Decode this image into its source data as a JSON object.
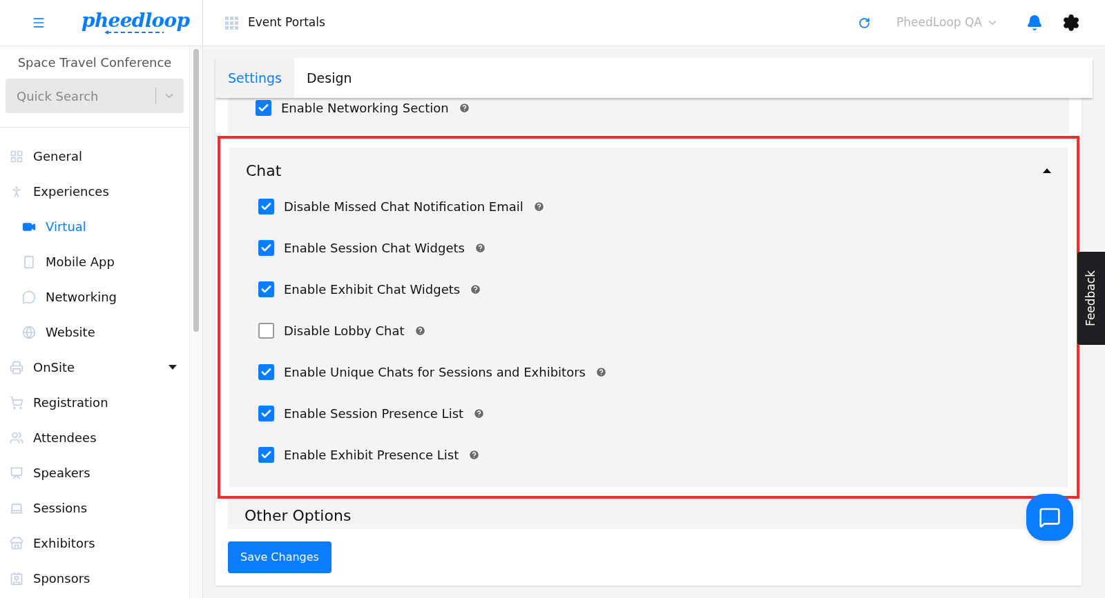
{
  "header": {
    "logo": "pheedloop",
    "title": "Event Portals",
    "account": "PheedLoop QA"
  },
  "sidebar": {
    "event_name": "Space Travel Conference",
    "search": {
      "placeholder": "Quick Search"
    },
    "items": [
      {
        "label": "General",
        "kind": "item",
        "selected": false
      },
      {
        "label": "Experiences",
        "kind": "item",
        "selected": false
      },
      {
        "label": "Virtual",
        "kind": "subitem",
        "selected": true
      },
      {
        "label": "Mobile App",
        "kind": "subitem",
        "selected": false
      },
      {
        "label": "Networking",
        "kind": "subitem",
        "selected": false
      },
      {
        "label": "Website",
        "kind": "subitem",
        "selected": false
      },
      {
        "label": "OnSite",
        "kind": "group",
        "selected": false,
        "expanded": false
      },
      {
        "label": "Registration",
        "kind": "item",
        "selected": false
      },
      {
        "label": "Attendees",
        "kind": "item",
        "selected": false
      },
      {
        "label": "Speakers",
        "kind": "item",
        "selected": false
      },
      {
        "label": "Sessions",
        "kind": "item",
        "selected": false
      },
      {
        "label": "Exhibitors",
        "kind": "item",
        "selected": false
      },
      {
        "label": "Sponsors",
        "kind": "item",
        "selected": false
      }
    ]
  },
  "tabs": [
    {
      "label": "Settings",
      "selected": true
    },
    {
      "label": "Design",
      "selected": false
    }
  ],
  "previous_option": {
    "label": "Enable Networking Section",
    "checked": true
  },
  "chat_section": {
    "title": "Chat",
    "expanded": true,
    "highlighted": true,
    "options": [
      {
        "label": "Disable Missed Chat Notification Email",
        "checked": true
      },
      {
        "label": "Enable Session Chat Widgets",
        "checked": true
      },
      {
        "label": "Enable Exhibit Chat Widgets",
        "checked": true
      },
      {
        "label": "Disable Lobby Chat",
        "checked": false
      },
      {
        "label": "Enable Unique Chats for Sessions and Exhibitors",
        "checked": true
      },
      {
        "label": "Enable Session Presence List",
        "checked": true
      },
      {
        "label": "Enable Exhibit Presence List",
        "checked": true
      }
    ]
  },
  "next_section": {
    "title": "Other Options"
  },
  "save_button": "Save Changes",
  "feedback_tab": "Feedback"
}
